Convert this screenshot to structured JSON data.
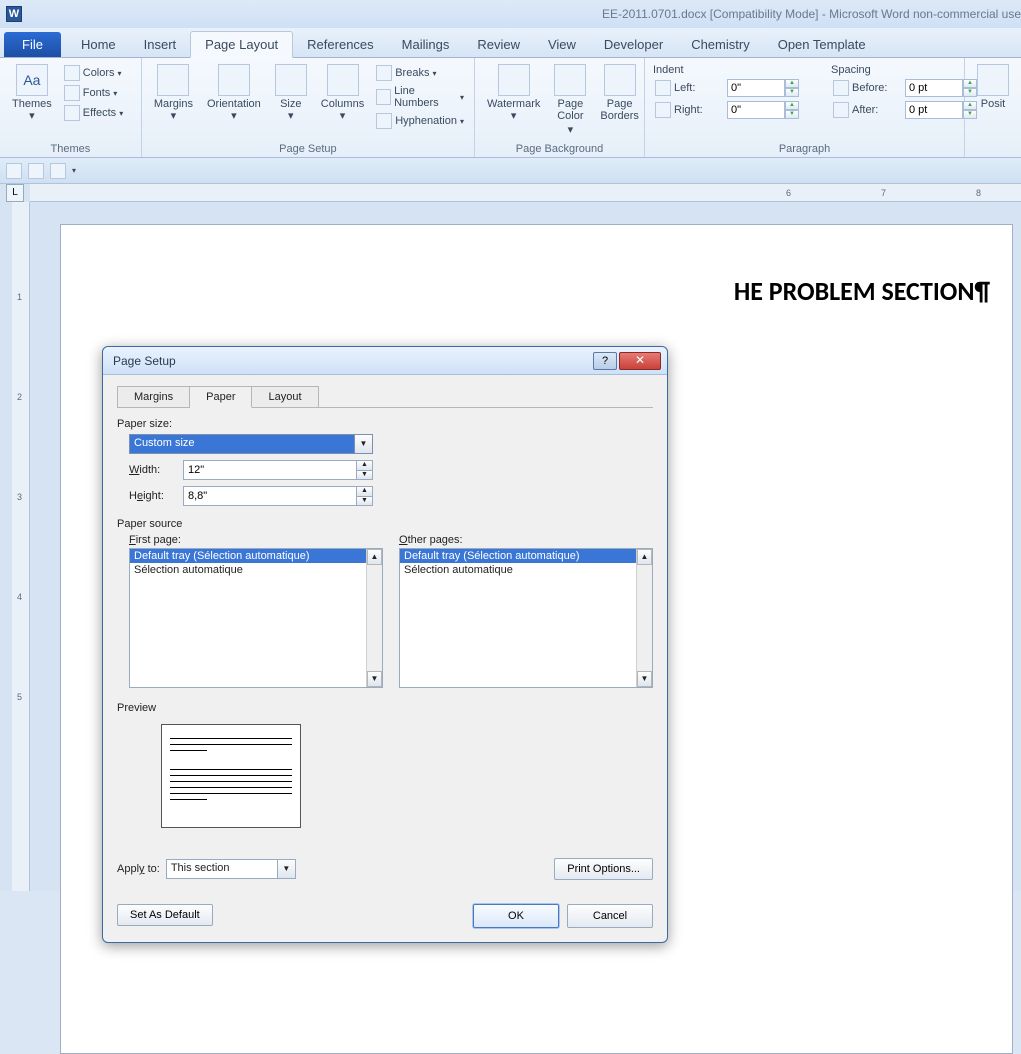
{
  "titlebar": {
    "document": "EE-2011.0701.docx [Compatibility Mode] - Microsoft Word non-commercial use"
  },
  "tabs": {
    "file": "File",
    "items": [
      "Home",
      "Insert",
      "Page Layout",
      "References",
      "Mailings",
      "Review",
      "View",
      "Developer",
      "Chemistry",
      "Open Template"
    ],
    "active": "Page Layout"
  },
  "ribbon": {
    "themes": {
      "label": "Themes",
      "themes_btn": "Themes",
      "colors": "Colors",
      "fonts": "Fonts",
      "effects": "Effects"
    },
    "pageSetup": {
      "label": "Page Setup",
      "margins": "Margins",
      "orientation": "Orientation",
      "size": "Size",
      "columns": "Columns",
      "breaks": "Breaks",
      "lineNumbers": "Line Numbers",
      "hyphenation": "Hyphenation"
    },
    "pageBg": {
      "label": "Page Background",
      "watermark": "Watermark",
      "pageColor": "Page\nColor",
      "pageBorders": "Page\nBorders"
    },
    "indent": {
      "header": "Indent",
      "left": "Left:",
      "leftVal": "0\"",
      "right": "Right:",
      "rightVal": "0\""
    },
    "spacing": {
      "header": "Spacing",
      "before": "Before:",
      "beforeVal": "0 pt",
      "after": "After:",
      "afterVal": "0 pt"
    },
    "paragraph": {
      "label": "Paragraph"
    },
    "arrange": {
      "position": "Posit"
    }
  },
  "ruler": {
    "h": [
      "6",
      "7",
      "8"
    ],
    "v": [
      "1",
      "2",
      "3",
      "4",
      "5"
    ]
  },
  "page": {
    "heading": "HE PROBLEM SECTION¶"
  },
  "dialog": {
    "title": "Page Setup",
    "tabs": [
      "Margins",
      "Paper",
      "Layout"
    ],
    "activeTab": "Paper",
    "paperSizeLabel": "Paper size:",
    "paperSize": "Custom size",
    "widthLabel": "Width:",
    "width": "12\"",
    "heightLabel": "Height:",
    "height": "8,8\"",
    "paperSourceLabel": "Paper source",
    "firstPageLabel": "First page:",
    "otherPagesLabel": "Other pages:",
    "trayOptions": [
      "Default tray (Sélection automatique)",
      "Sélection automatique"
    ],
    "previewLabel": "Preview",
    "applyToLabel": "Apply to:",
    "applyTo": "This section",
    "printOptions": "Print Options...",
    "setDefault": "Set As Default",
    "ok": "OK",
    "cancel": "Cancel"
  }
}
